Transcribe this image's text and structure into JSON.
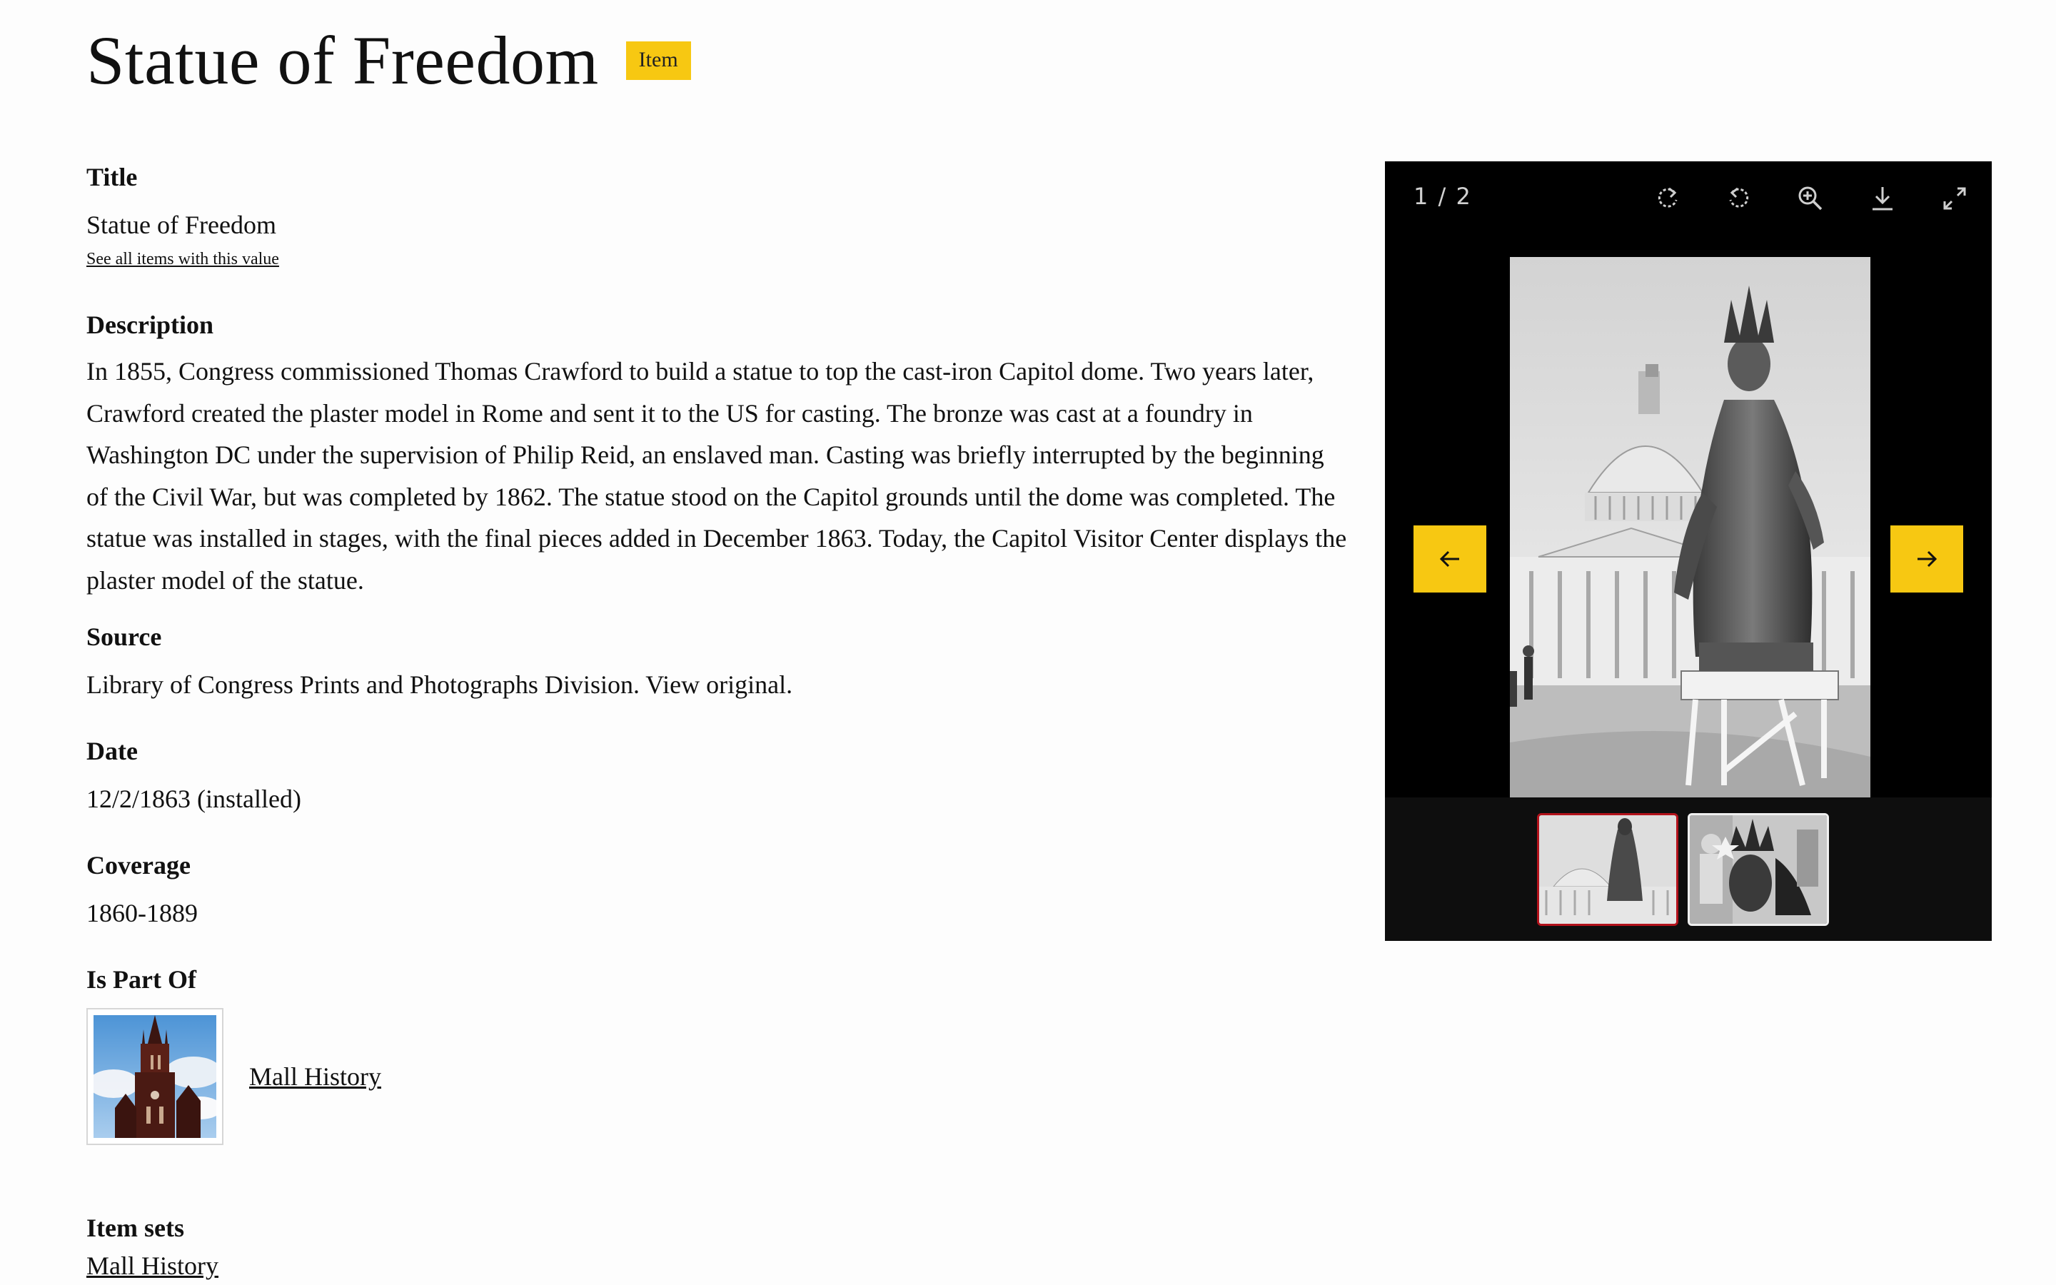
{
  "page": {
    "title": "Statue of Freedom",
    "type_badge": "Item"
  },
  "fields": {
    "title_label": "Title",
    "title_value": "Statue of Freedom",
    "see_all_link": "See all items with this value",
    "description_label": "Description",
    "description_value": "In 1855, Congress commissioned Thomas Crawford to build a statue to top the cast-iron Capitol dome. Two years later, Crawford created the plaster model in Rome and sent it to the US for casting. The bronze was cast at a foundry in Washington DC under the supervision of Philip Reid, an enslaved man. Casting was briefly interrupted by the beginning of the Civil War, but was completed by 1862. The statue stood on the Capitol grounds until the dome was completed. The statue was installed in stages, with the final pieces added in December 1863. Today, the Capitol Visitor Center displays the plaster model of the statue.",
    "source_label": "Source",
    "source_value": "Library of Congress Prints and Photographs Division. View original.",
    "date_label": "Date",
    "date_value": "12/2/1863 (installed)",
    "coverage_label": "Coverage",
    "coverage_value": "1860-1889",
    "part_of_label": "Is Part Of",
    "part_of_link": "Mall History",
    "item_sets_label": "Item sets",
    "item_sets_link": "Mall History"
  },
  "viewer": {
    "counter": "1 / 2",
    "tools": [
      "rotate-clockwise-icon",
      "rotate-counterclockwise-icon",
      "zoom-in-icon",
      "download-icon",
      "fullscreen-icon"
    ],
    "active_thumbnail": 1,
    "thumbnail_count": 2,
    "accent_color": "#f7c812",
    "active_border_color": "#b3121b"
  }
}
